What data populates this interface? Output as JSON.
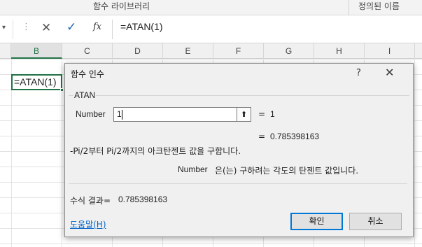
{
  "ribbon": {
    "group_function_library": "함수 라이브러리",
    "group_defined_names": "정의된 이름"
  },
  "formula_bar": {
    "cancel_icon": "✕",
    "enter_icon": "✓",
    "fx_label": "fx",
    "formula": "=ATAN(1)"
  },
  "columns": [
    "B",
    "C",
    "D",
    "E",
    "F",
    "G",
    "H",
    "I"
  ],
  "active_cell": {
    "column": "B",
    "content": "=ATAN(1)"
  },
  "dialog": {
    "title": "함수 인수",
    "help_icon": "?",
    "close_icon": "✕",
    "function_name": "ATAN",
    "argument": {
      "label": "Number",
      "value": "1",
      "evaluated_eq": "=",
      "evaluated": "1"
    },
    "result_eq": "=",
    "result": "0.785398163",
    "description": "-Pi/2부터 Pi/2까지의 아크탄젠트 값을 구합니다.",
    "argument_description_name": "Number",
    "argument_description": "은(는) 구하려는 각도의 탄젠트 값입니다.",
    "formula_result_label": "수식 결과=",
    "formula_result": "0.785398163",
    "help_link": "도움말(H)",
    "ok_button": "확인",
    "cancel_button": "취소"
  },
  "colors": {
    "excel_green": "#217346",
    "focus_blue": "#0078d7",
    "link_blue": "#0066cc"
  }
}
